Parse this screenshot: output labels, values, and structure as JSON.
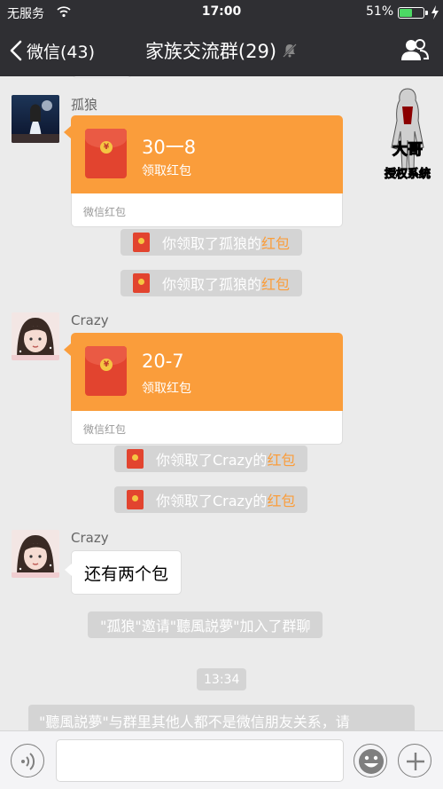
{
  "status_bar": {
    "carrier": "无服务",
    "time": "17:00",
    "battery_percent": "51%",
    "battery_level": 0.51,
    "icons": [
      "wifi-icon",
      "battery-icon",
      "charging-icon"
    ]
  },
  "nav": {
    "back_label": "微信(43)",
    "title": "家族交流群(29)",
    "icons": [
      "chevron-left-icon",
      "mute-icon",
      "group-members-icon"
    ]
  },
  "overlay": {
    "caption_top": "大哥",
    "caption_bottom": "授权系统"
  },
  "messages": {
    "m1": {
      "sender": "孤狼",
      "amount_text": "30一8",
      "action": "领取红包",
      "footer": "微信红包"
    },
    "s1": {
      "prefix": "你领取了孤狼的",
      "highlight": "红包"
    },
    "s2": {
      "prefix": "你领取了孤狼的",
      "highlight": "红包"
    },
    "m2": {
      "sender": "Crazy",
      "amount_text": "20-7",
      "action": "领取红包",
      "footer": "微信红包"
    },
    "s3": {
      "prefix": "你领取了Crazy的",
      "highlight": "红包"
    },
    "s4": {
      "prefix": "你领取了Crazy的",
      "highlight": "红包"
    },
    "m3": {
      "sender": "Crazy",
      "text": "还有两个包"
    },
    "invite": "\"孤狼\"邀请\"聽風説夢\"加入了群聊",
    "time": "13:34",
    "notice": "\"聽風説夢\"与群里其他人都不是微信朋友关系，请"
  },
  "colors": {
    "bar": "#2f2f33",
    "chat_bg": "#ebebeb",
    "red_packet": "#fa9d3b",
    "highlight": "#fa9d3b",
    "system_pill": "#d4d4d4"
  }
}
